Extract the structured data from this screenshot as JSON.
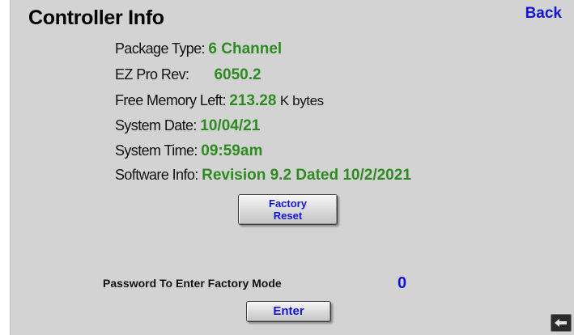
{
  "header": {
    "title": "Controller Info",
    "back_label": "Back"
  },
  "info": {
    "package_type_label": "Package Type:",
    "package_type_value": "6 Channel",
    "ez_pro_rev_label": "EZ Pro Rev:",
    "ez_pro_rev_value": "6050.2",
    "free_memory_label": "Free Memory Left:",
    "free_memory_value": "213.28",
    "free_memory_unit": "K bytes",
    "system_date_label": "System Date:",
    "system_date_value": "10/04/21",
    "system_time_label": "System Time:",
    "system_time_value": "09:59",
    "system_time_ampm": "am",
    "software_info_label": "Software Info:",
    "software_info_value": "Revision 9.2 Dated 10/2/2021"
  },
  "factory_reset": {
    "line1": "Factory",
    "line2": "Reset"
  },
  "password": {
    "label": "Password To Enter Factory Mode",
    "value": "0"
  },
  "enter_label": "Enter",
  "colors": {
    "background": "#d3d3d3",
    "value_green": "#2e8b22",
    "link_blue": "#1414d6"
  },
  "icons": {
    "corner": "back-arrow-icon"
  }
}
